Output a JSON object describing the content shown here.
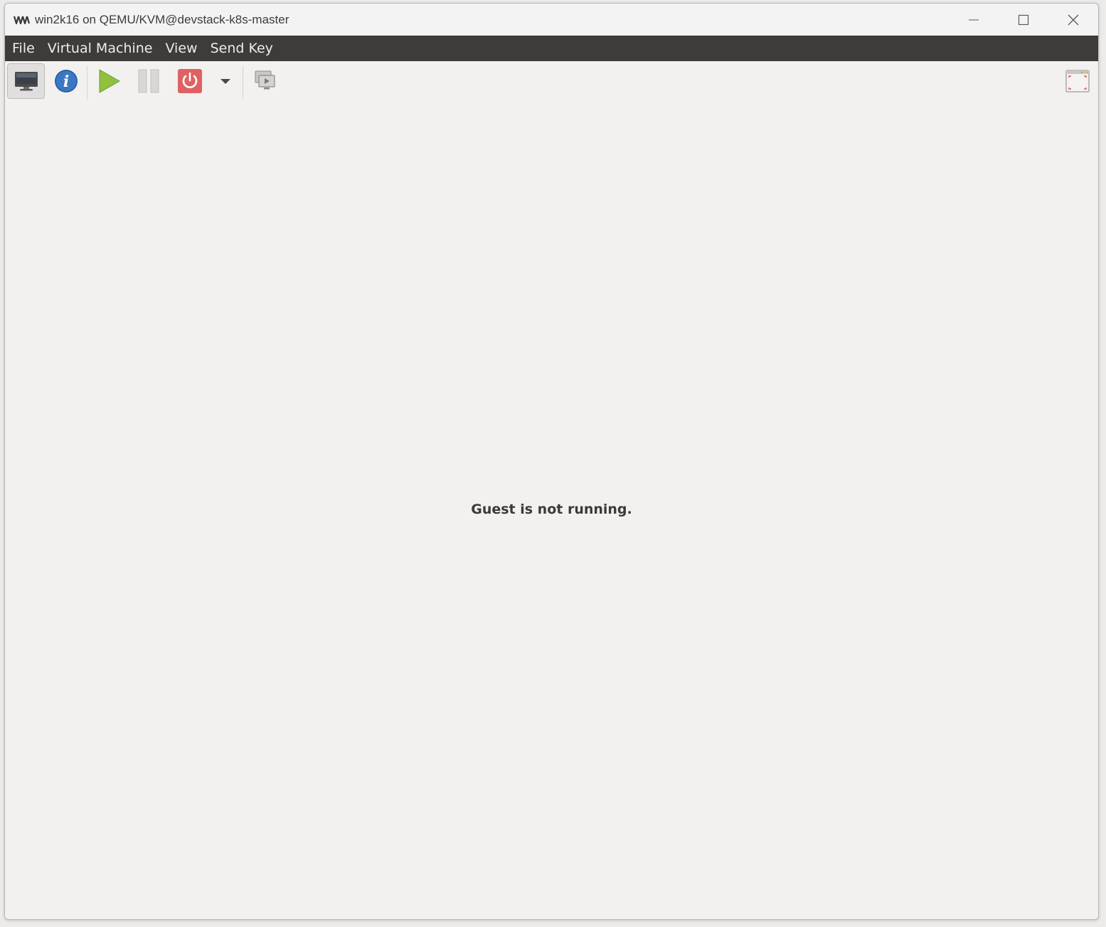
{
  "window": {
    "title": "win2k16 on QEMU/KVM@devstack-k8s-master",
    "app_icon": "virt-manager-icon",
    "controls": [
      "minimize-icon",
      "maximize-icon",
      "close-icon"
    ]
  },
  "menubar": {
    "items": [
      {
        "label": "File"
      },
      {
        "label": "Virtual Machine"
      },
      {
        "label": "View"
      },
      {
        "label": "Send Key"
      }
    ]
  },
  "toolbar": {
    "buttons": [
      {
        "icon": "console-monitor-icon",
        "active": true
      },
      {
        "icon": "details-info-icon"
      },
      {
        "icon": "run-play-icon"
      },
      {
        "icon": "pause-icon"
      },
      {
        "icon": "shutdown-power-icon"
      },
      {
        "icon": "shutdown-menu-chevron-icon"
      },
      {
        "icon": "snapshots-icon"
      },
      {
        "icon": "fullscreen-icon"
      }
    ]
  },
  "main": {
    "status_message": "Guest is not running."
  },
  "colors": {
    "menubar_bg": "#3d3c3a",
    "window_bg": "#f2f1f0",
    "play_green": "#8fc13e",
    "power_red": "#e06161",
    "info_blue": "#3a78c2"
  }
}
